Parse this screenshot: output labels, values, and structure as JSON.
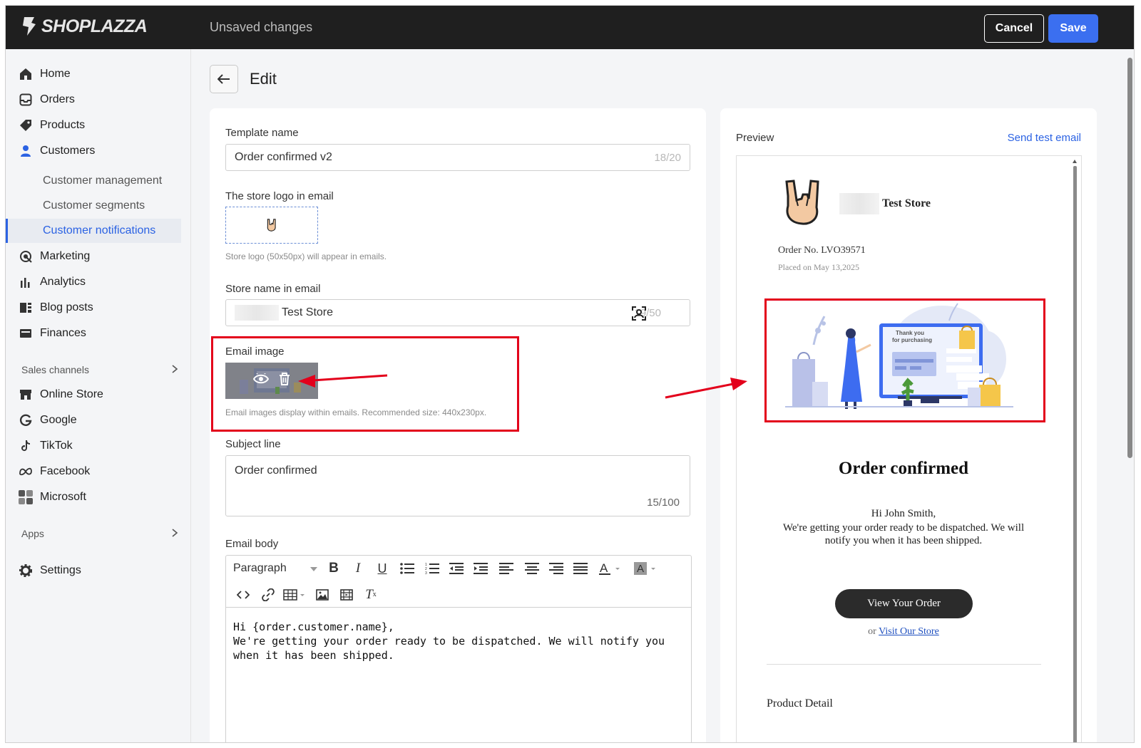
{
  "topbar": {
    "brand": "SHOPLAZZA",
    "status": "Unsaved changes",
    "cancel_label": "Cancel",
    "save_label": "Save"
  },
  "sidebar": {
    "items": [
      {
        "label": "Home",
        "icon": "home-icon"
      },
      {
        "label": "Orders",
        "icon": "orders-icon"
      },
      {
        "label": "Products",
        "icon": "tag-icon"
      },
      {
        "label": "Customers",
        "icon": "person-icon"
      },
      {
        "label": "Marketing",
        "icon": "marketing-icon"
      },
      {
        "label": "Analytics",
        "icon": "bar-chart-icon"
      },
      {
        "label": "Blog posts",
        "icon": "blog-icon"
      },
      {
        "label": "Finances",
        "icon": "finance-icon"
      }
    ],
    "customer_subitems": [
      "Customer management",
      "Customer segments",
      "Customer notifications"
    ],
    "sales_channels_label": "Sales channels",
    "channels": [
      {
        "label": "Online Store",
        "icon": "store-icon"
      },
      {
        "label": "Google",
        "icon": "google-icon"
      },
      {
        "label": "TikTok",
        "icon": "tiktok-icon"
      },
      {
        "label": "Facebook",
        "icon": "meta-icon"
      },
      {
        "label": "Microsoft",
        "icon": "microsoft-icon"
      }
    ],
    "apps_label": "Apps",
    "settings_label": "Settings"
  },
  "page": {
    "title": "Edit"
  },
  "form": {
    "template_name_label": "Template name",
    "template_name_value": "Order confirmed v2",
    "template_name_count": "18/20",
    "logo_label": "The store logo in email",
    "logo_help": "Store logo (50x50px) will appear in emails.",
    "store_name_label": "Store name in email",
    "store_name_value": "Test Store",
    "store_name_count": "19/50",
    "email_image_label": "Email image",
    "email_image_help": "Email images display within emails. Recommended size: 440x230px.",
    "subject_label": "Subject line",
    "subject_value": "Order confirmed",
    "subject_count": "15/100",
    "body_label": "Email body",
    "paragraph_select": "Paragraph",
    "body_line1": "Hi {order.customer.name},",
    "body_line2": "We're getting your order ready to be dispatched. We will notify you when it has been shipped."
  },
  "preview": {
    "title": "Preview",
    "send_test": "Send test email",
    "store_name": "Test Store",
    "order_no": "Order No. LVO39571",
    "placed_on": "Placed on May 13,2025",
    "hero_text_line1": "Thank you",
    "hero_text_line2": "for purchasing",
    "heading": "Order confirmed",
    "greeting": "Hi John Smith,",
    "body": "We're getting your order ready to be dispatched. We will notify you when it has been shipped.",
    "view_order": "View Your Order",
    "or_text": "or",
    "visit_store": "Visit Our Store",
    "product_detail": "Product Detail"
  },
  "colors": {
    "accent": "#2b62e3",
    "save_button": "#3b6ff0",
    "topbar": "#1f1f1f",
    "annotation_red": "#e3001b"
  }
}
